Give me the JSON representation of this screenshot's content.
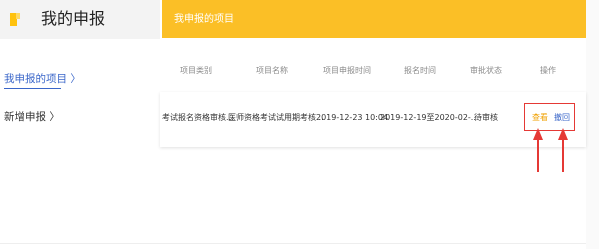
{
  "sidebar": {
    "title": "我的申报",
    "items": [
      {
        "label": "我申报的项目 〉"
      },
      {
        "label": "新增申报 〉"
      }
    ]
  },
  "header": {
    "title": "我申报的项目"
  },
  "table": {
    "columns": [
      "项目类别",
      "项目名称",
      "项目申报时间",
      "报名时间",
      "审批状态",
      "操作"
    ],
    "rows": [
      {
        "category": "考试报名资格审核...",
        "name": "医师资格考试试用期考核...",
        "apply_time": "2019-12-23 10:04",
        "signup_time": "2019-12-19至2020-02-...",
        "status": "待审核",
        "actions": {
          "view": "查看",
          "revoke": "撤回"
        }
      }
    ]
  },
  "colors": {
    "accent": "#fbbf26",
    "link": "#3a66c9",
    "highlight": "#e53935"
  }
}
